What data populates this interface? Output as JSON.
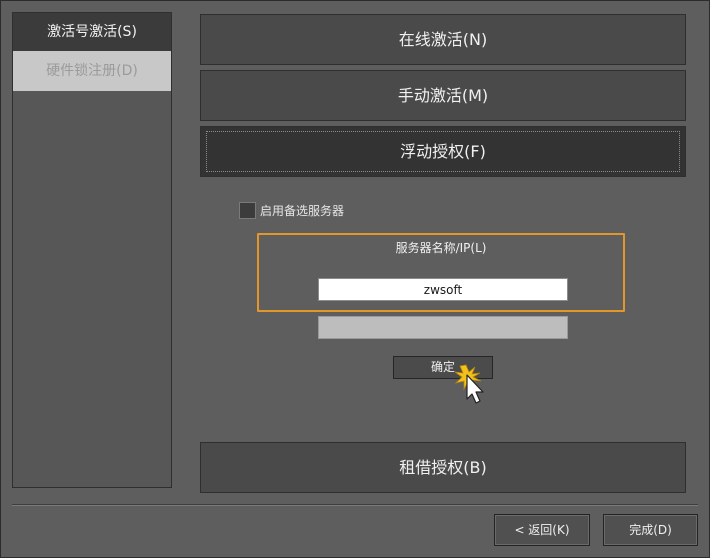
{
  "sidebar": {
    "items": [
      {
        "label": "激活号激活(S)",
        "state": "active"
      },
      {
        "label": "硬件锁注册(D)",
        "state": "disabled"
      }
    ]
  },
  "modes": {
    "online": "在线激活(N)",
    "manual": "手动激活(M)",
    "floating": "浮动授权(F)",
    "borrow": "租借授权(B)"
  },
  "floating_panel": {
    "alternate_server_label": "启用备选服务器",
    "alternate_server_checked": false,
    "server_name_label": "服务器名称/IP(L)",
    "server_name_value": "zwsoft",
    "confirm_label": "确定"
  },
  "footer": {
    "back_label": "< 返回(K)",
    "finish_label": "完成(D)"
  },
  "colors": {
    "highlight": "#e3962a",
    "click_burst": "#f2c21b"
  }
}
